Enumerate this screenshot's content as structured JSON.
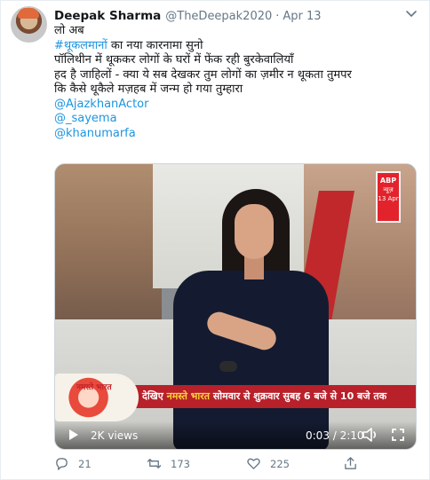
{
  "tweet": {
    "author_name": "Deepak Sharma",
    "author_handle": "@TheDeepak2020",
    "separator": "·",
    "date": "Apr 13",
    "text_line1": "लो अब",
    "hashtag": "#थूकलमानों",
    "text_line2_rest": " का नया कारनामा सुनो",
    "text_line3": "पॉलिथीन में थूककर लोगों के घरों में फेंक रही बुरकेवालियाँ",
    "text_line4": "हद है जाहिलों - क्या ये सब देखकर तुम लोगों का ज़मीर न थूकता तुमपर",
    "text_line5": "कि कैसे थूकैले मज़हब में जन्म हो गया तुम्हारा",
    "mentions": [
      "@AjazkhanActor",
      "@_sayema",
      "@khanumarfa"
    ]
  },
  "video": {
    "channel_logo_top": "ABP",
    "channel_logo_bottom": "न्यूज़",
    "channel_date": "13 Apr",
    "show_logo": "नमस्ते भारत",
    "ticker_prefix": "देखिए ",
    "ticker_highlight": "नमस्ते भारत",
    "ticker_rest": " सोमवार से शुक्रवार सुबह 6 बजे से 10 बजे तक",
    "views": "2K views",
    "time": "0:03 / 2:10",
    "icons": [
      "play-icon",
      "volume-icon",
      "fullscreen-icon"
    ]
  },
  "actions": {
    "replies": "21",
    "retweets": "173",
    "likes": "225",
    "icons": [
      "reply-icon",
      "retweet-icon",
      "like-icon",
      "share-icon"
    ]
  },
  "colors": {
    "link": "#1b95e0",
    "muted": "#657786",
    "ticker_red": "#b8202a",
    "ticker_highlight": "#ffd23a"
  }
}
